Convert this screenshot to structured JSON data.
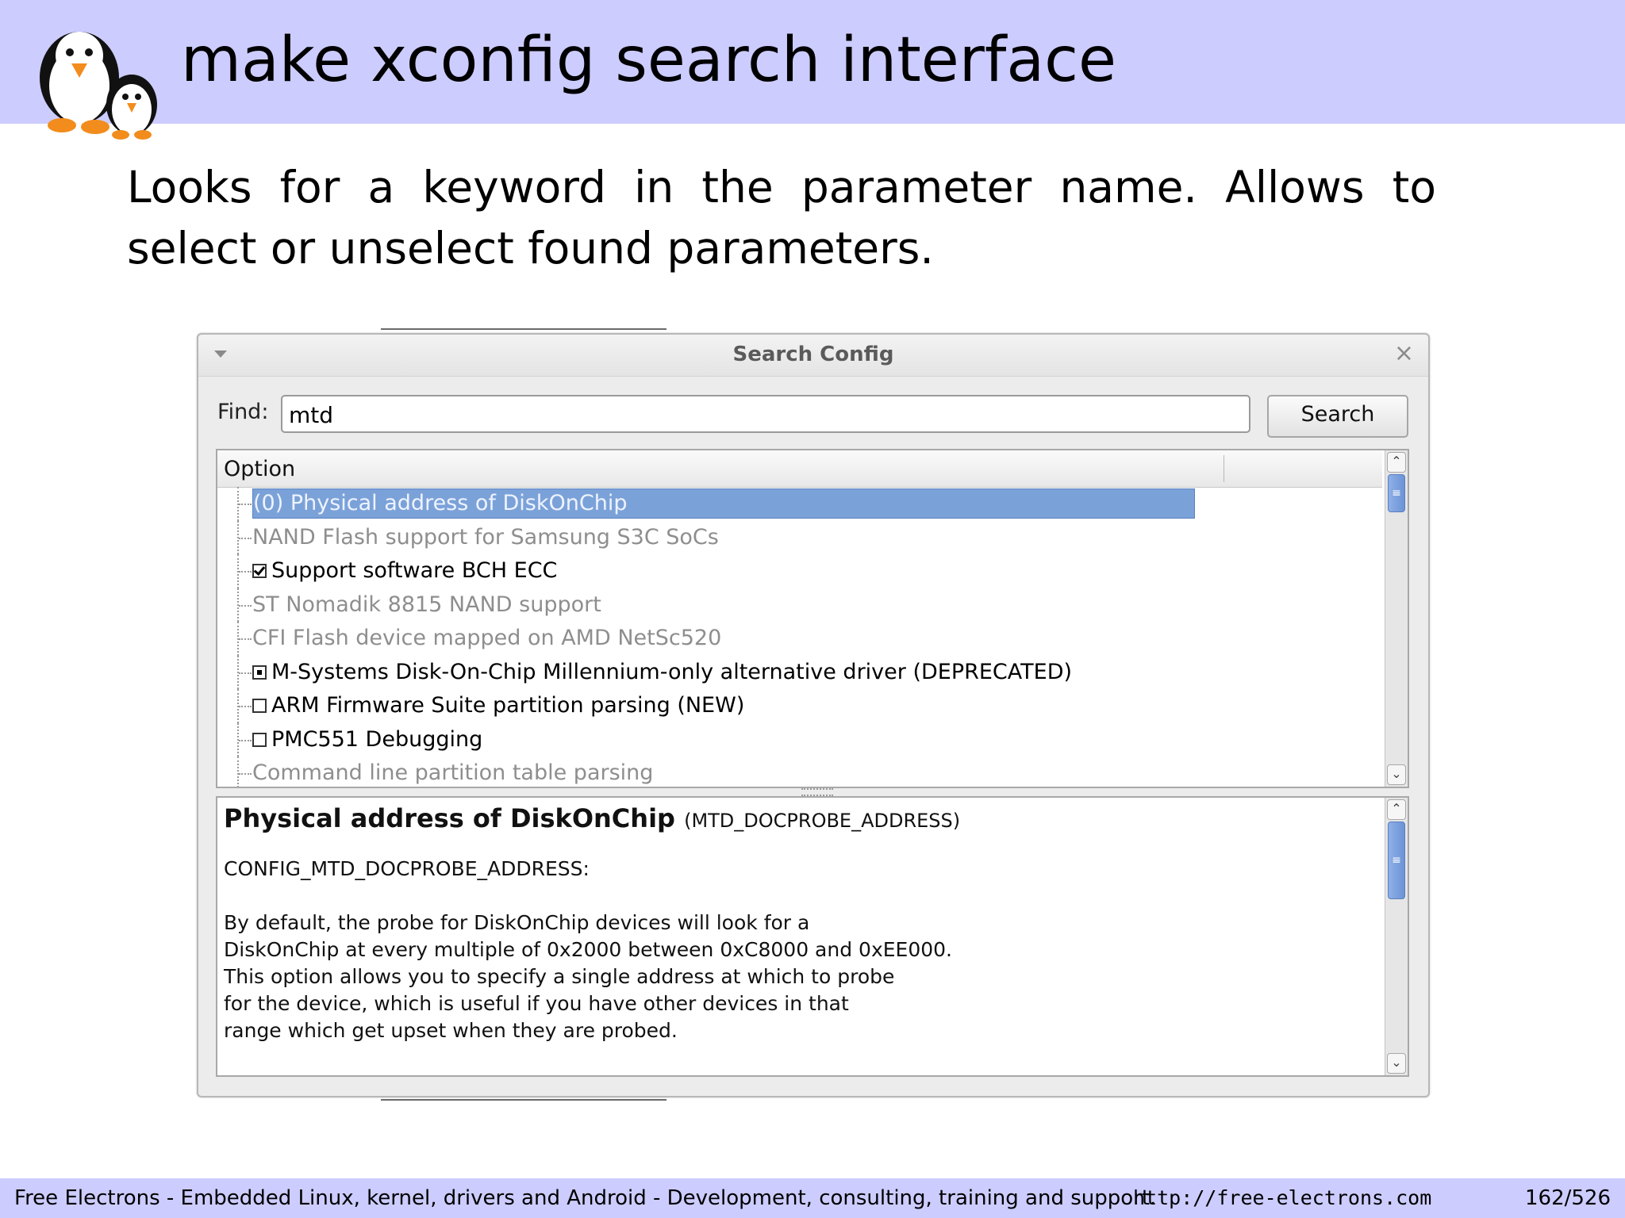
{
  "slide": {
    "title": "make xconfig search interface",
    "intro": "Looks for a keyword in the parameter name. Allows to select or unselect found parameters.",
    "footer_text": "Free Electrons - Embedded Linux, kernel, drivers and Android - Development, consulting, training and support.",
    "footer_url": "http://free-electrons.com",
    "page_number": "162/526"
  },
  "dialog": {
    "title": "Search Config",
    "close_glyph": "×",
    "find_label": "Find:",
    "find_value": "mtd",
    "search_label": "Search",
    "option_column_header": "Option",
    "scroll_up_glyph": "⌃",
    "scroll_down_glyph": "⌄",
    "thumb_glyph": "≡",
    "rows": [
      {
        "label": "(0) Physical address of DiskOnChip",
        "state": "selected",
        "checkbox": "none"
      },
      {
        "label": "NAND Flash support for Samsung S3C SoCs",
        "state": "disabled",
        "checkbox": "none"
      },
      {
        "label": "Support software BCH ECC",
        "state": "normal",
        "checkbox": "checked"
      },
      {
        "label": "ST Nomadik 8815 NAND support",
        "state": "disabled",
        "checkbox": "none"
      },
      {
        "label": "CFI Flash device mapped on AMD NetSc520",
        "state": "disabled",
        "checkbox": "none"
      },
      {
        "label": "M-Systems Disk-On-Chip Millennium-only alternative driver (DEPRECATED)",
        "state": "normal",
        "checkbox": "module"
      },
      {
        "label": "ARM Firmware Suite partition parsing (NEW)",
        "state": "normal",
        "checkbox": "unchecked"
      },
      {
        "label": "PMC551 Debugging",
        "state": "normal",
        "checkbox": "unchecked"
      },
      {
        "label": "Command line partition table parsing",
        "state": "disabled",
        "checkbox": "none"
      }
    ],
    "info": {
      "heading": "Physical address of DiskOnChip",
      "symbol": "(MTD_DOCPROBE_ADDRESS)",
      "config_name": "CONFIG_MTD_DOCPROBE_ADDRESS:",
      "help_lines": [
        "By default, the probe for DiskOnChip devices will look for a",
        "DiskOnChip at every multiple of 0x2000 between 0xC8000 and 0xEE000.",
        "This option allows you to specify a single address at which to probe",
        "for the device, which is useful if you have other devices in that",
        "range which get upset when they are probed."
      ]
    }
  },
  "colors": {
    "header_band": "#ccccff",
    "selection": "#7ba2d8",
    "disabled_text": "#8e8e8e"
  }
}
